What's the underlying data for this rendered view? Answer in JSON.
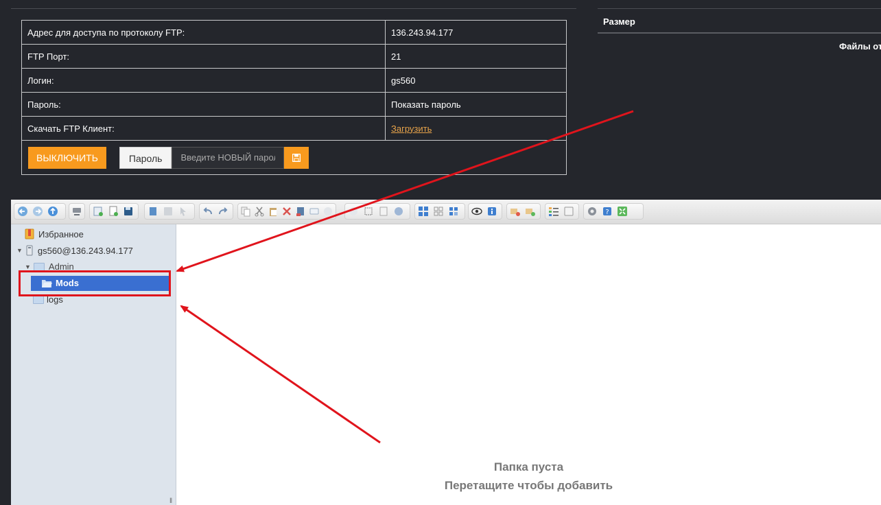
{
  "ftp_table": {
    "rows": [
      {
        "label": "Адрес для доступа по протоколу FTP:",
        "value": "136.243.94.177"
      },
      {
        "label": "FTP Порт:",
        "value": "21"
      },
      {
        "label": "Логин:",
        "value": "gs560"
      },
      {
        "label": "Пароль:",
        "value": "Показать пароль"
      },
      {
        "label": "Скачать FTP Клиент:",
        "value": "Загрузить"
      }
    ],
    "disable_button": "ВЫКЛЮЧИТЬ",
    "password_label": "Пароль",
    "password_placeholder": "Введите НОВЫЙ пароль",
    "save_icon": "floppy-disk-icon"
  },
  "right_panel": {
    "size_header": "Размер",
    "files_text": "Файлы от"
  },
  "file_manager": {
    "toolbar_icons": [
      "back-icon",
      "forward-icon",
      "up-icon",
      "netmount-icon",
      "mkdir-icon",
      "mkfile-icon",
      "save-icon",
      "open-icon",
      "download-icon",
      "select-icon",
      "undo-icon",
      "redo-icon",
      "copy-icon",
      "cut-icon",
      "paste-icon",
      "delete-icon",
      "empty-icon",
      "rename-icon",
      "duplicate-icon",
      "edit-icon",
      "resize-icon",
      "extract-icon",
      "archive-icon",
      "view-icons-icon",
      "view-list-icon",
      "preview-icon",
      "info-icon",
      "sort-icon",
      "places-icon",
      "columns-icon",
      "help-icon",
      "settings-icon",
      "about-icon",
      "fullscreen-icon"
    ],
    "tree": {
      "favorites": "Избранное",
      "root": "gs560@136.243.94.177",
      "folders": [
        "Admin",
        "Mods",
        "logs"
      ],
      "selected": "Mods"
    },
    "empty_title": "Папка пуста",
    "empty_hint": "Перетащите чтобы добавить"
  },
  "colors": {
    "accent": "#f89a1e",
    "selection": "#3a6fd1",
    "annotation": "#e0141c"
  }
}
